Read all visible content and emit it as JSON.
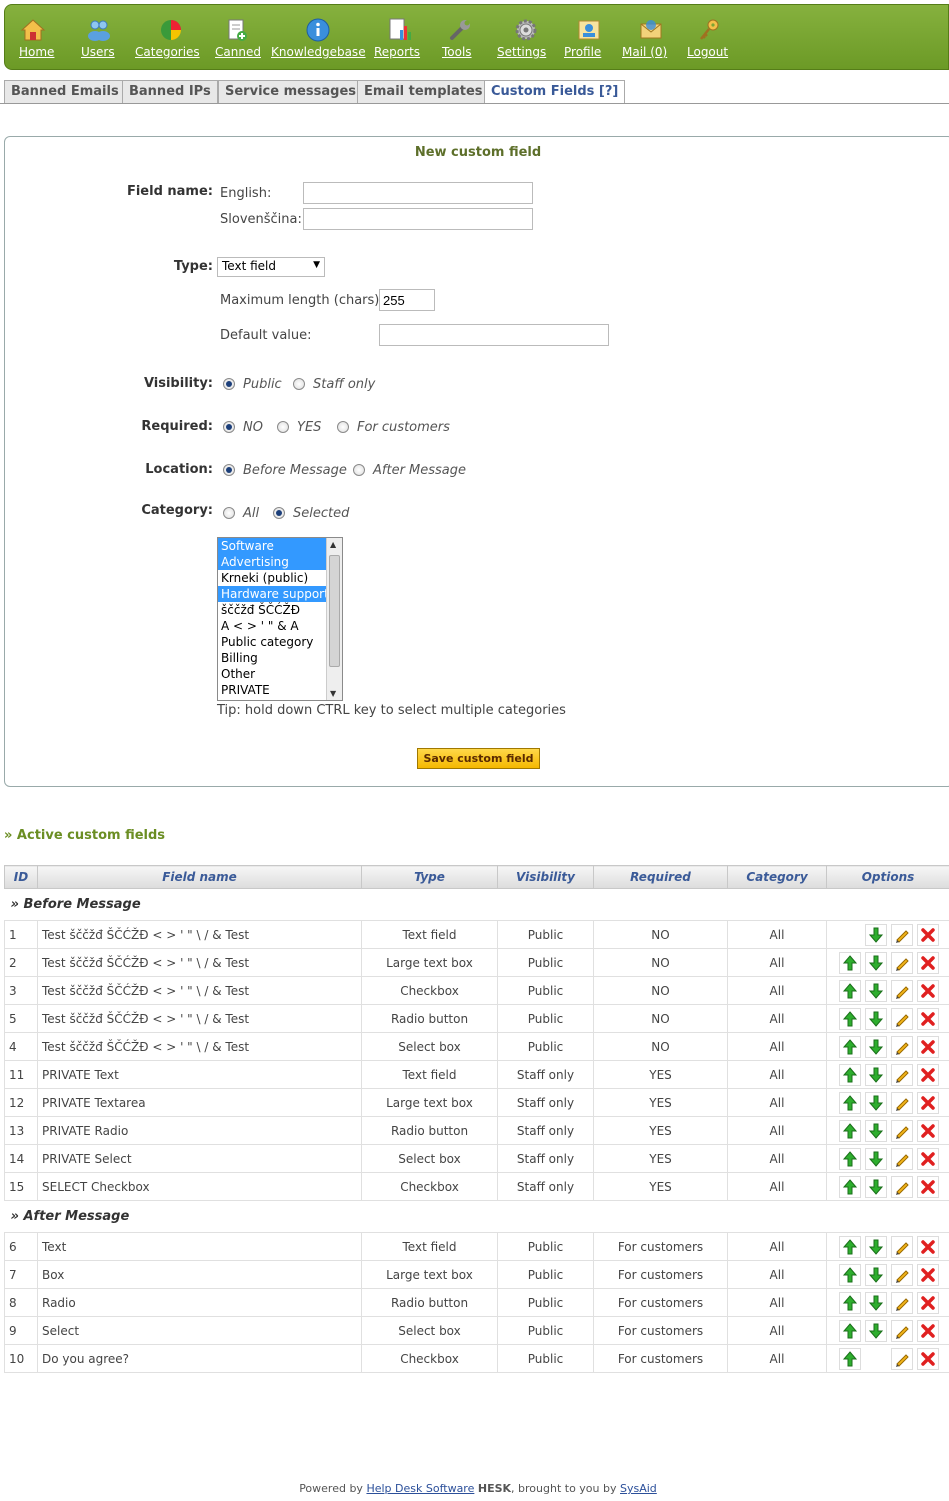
{
  "nav": {
    "items": [
      {
        "label": "Home",
        "icon": "home-icon"
      },
      {
        "label": "Users",
        "icon": "users-icon"
      },
      {
        "label": "Categories",
        "icon": "pie-chart-icon"
      },
      {
        "label": "Canned",
        "icon": "canned-document-icon"
      },
      {
        "label": "Knowledgebase",
        "icon": "info-icon"
      },
      {
        "label": "Reports",
        "icon": "reports-icon"
      },
      {
        "label": "Tools",
        "icon": "wrench-icon"
      },
      {
        "label": "Settings",
        "icon": "gear-icon"
      },
      {
        "label": "Profile",
        "icon": "profile-icon"
      },
      {
        "label": "Mail (0)",
        "icon": "mail-icon"
      },
      {
        "label": "Logout",
        "icon": "key-icon"
      }
    ],
    "colors": {
      "bar": "#7aa535",
      "label": "#ffffff"
    }
  },
  "tabs": [
    {
      "label": "Banned Emails",
      "active": false
    },
    {
      "label": "Banned IPs",
      "active": false
    },
    {
      "label": "Service messages",
      "active": false
    },
    {
      "label": "Email templates",
      "active": false
    },
    {
      "label": "Custom Fields [?]",
      "active": true
    }
  ],
  "form": {
    "title": "New custom field",
    "field_name_label": "Field name:",
    "lang_english": "English:",
    "lang_slovenscina": "Slovenščina:",
    "type_label": "Type:",
    "type_value": "Text field",
    "max_length_label": "Maximum length (chars):",
    "max_length_value": "255",
    "default_value_label": "Default value:",
    "visibility_label": "Visibility:",
    "visibility_options": [
      "Public",
      "Staff only"
    ],
    "visibility_selected": "Public",
    "required_label": "Required:",
    "required_options": [
      "NO",
      "YES",
      "For customers"
    ],
    "required_selected": "NO",
    "location_label": "Location:",
    "location_options": [
      "Before Message",
      "After Message"
    ],
    "location_selected": "Before Message",
    "category_label": "Category:",
    "category_options": [
      "All",
      "Selected"
    ],
    "category_selected": "Selected",
    "categories": [
      {
        "name": "Software",
        "selected": true
      },
      {
        "name": "Advertising",
        "selected": true
      },
      {
        "name": "Krneki (public)",
        "selected": false
      },
      {
        "name": "Hardware support",
        "selected": true
      },
      {
        "name": "šččžđ ŠČĆŽĐ",
        "selected": false
      },
      {
        "name": "A < > ' \" & A",
        "selected": false
      },
      {
        "name": "Public category",
        "selected": false
      },
      {
        "name": "Billing",
        "selected": false
      },
      {
        "name": "Other",
        "selected": false
      },
      {
        "name": "PRIVATE",
        "selected": false
      }
    ],
    "tip": "Tip: hold down CTRL key to select multiple categories",
    "save_label": "Save custom field"
  },
  "active_fields": {
    "title": "» Active custom fields",
    "columns": [
      "ID",
      "Field name",
      "Type",
      "Visibility",
      "Required",
      "Category",
      "Options"
    ],
    "groups": [
      {
        "label": "» Before Message",
        "rows": [
          {
            "id": "1",
            "name": "Test šččžđ ŠČĆŽĐ < > ' \" \\ / & Test",
            "type": "Text field",
            "visibility": "Public",
            "required": "NO",
            "category": "All",
            "up": false,
            "down": true
          },
          {
            "id": "2",
            "name": "Test šččžđ ŠČĆŽĐ < > ' \" \\ / & Test",
            "type": "Large text box",
            "visibility": "Public",
            "required": "NO",
            "category": "All",
            "up": true,
            "down": true
          },
          {
            "id": "3",
            "name": "Test šččžđ ŠČĆŽĐ < > ' \" \\ / & Test",
            "type": "Checkbox",
            "visibility": "Public",
            "required": "NO",
            "category": "All",
            "up": true,
            "down": true
          },
          {
            "id": "5",
            "name": "Test šččžđ ŠČĆŽĐ < > ' \" \\ / & Test",
            "type": "Radio button",
            "visibility": "Public",
            "required": "NO",
            "category": "All",
            "up": true,
            "down": true
          },
          {
            "id": "4",
            "name": "Test šččžđ ŠČĆŽĐ < > ' \" \\ / & Test",
            "type": "Select box",
            "visibility": "Public",
            "required": "NO",
            "category": "All",
            "up": true,
            "down": true
          },
          {
            "id": "11",
            "name": "PRIVATE Text",
            "type": "Text field",
            "visibility": "Staff only",
            "required": "YES",
            "category": "All",
            "up": true,
            "down": true
          },
          {
            "id": "12",
            "name": "PRIVATE Textarea",
            "type": "Large text box",
            "visibility": "Staff only",
            "required": "YES",
            "category": "All",
            "up": true,
            "down": true
          },
          {
            "id": "13",
            "name": "PRIVATE Radio",
            "type": "Radio button",
            "visibility": "Staff only",
            "required": "YES",
            "category": "All",
            "up": true,
            "down": true
          },
          {
            "id": "14",
            "name": "PRIVATE Select",
            "type": "Select box",
            "visibility": "Staff only",
            "required": "YES",
            "category": "All",
            "up": true,
            "down": true
          },
          {
            "id": "15",
            "name": "SELECT Checkbox",
            "type": "Checkbox",
            "visibility": "Staff only",
            "required": "YES",
            "category": "All",
            "up": true,
            "down": true
          }
        ]
      },
      {
        "label": "» After Message",
        "rows": [
          {
            "id": "6",
            "name": "Text",
            "type": "Text field",
            "visibility": "Public",
            "required": "For customers",
            "category": "All",
            "up": true,
            "down": true
          },
          {
            "id": "7",
            "name": "Box",
            "type": "Large text box",
            "visibility": "Public",
            "required": "For customers",
            "category": "All",
            "up": true,
            "down": true
          },
          {
            "id": "8",
            "name": "Radio",
            "type": "Radio button",
            "visibility": "Public",
            "required": "For customers",
            "category": "All",
            "up": true,
            "down": true
          },
          {
            "id": "9",
            "name": "Select",
            "type": "Select box",
            "visibility": "Public",
            "required": "For customers",
            "category": "All",
            "up": true,
            "down": true
          },
          {
            "id": "10",
            "name": "Do you agree?",
            "type": "Checkbox",
            "visibility": "Public",
            "required": "For customers",
            "category": "All",
            "up": true,
            "down": false
          }
        ]
      }
    ]
  },
  "footer": {
    "prefix": "Powered by",
    "link1": "Help Desk Software",
    "brand": "HESK",
    "middle": ", brought to you by",
    "link2": "SysAid"
  }
}
